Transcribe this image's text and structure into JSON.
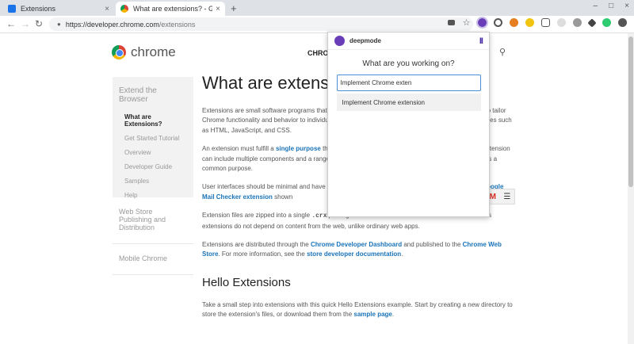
{
  "tabs": [
    {
      "title": "Extensions",
      "close": "×"
    },
    {
      "title": "What are extensions? - Google Chrome",
      "close": "×"
    }
  ],
  "new_tab": "+",
  "window_controls": {
    "minimize": "–",
    "maximize": "□",
    "close": "×"
  },
  "toolbar": {
    "back": "←",
    "forward": "→",
    "reload": "↻",
    "url_host": "https://developer.chrome.com",
    "url_path": "/extensions",
    "lock": "🔒",
    "star": "☆",
    "menu": "⋮"
  },
  "page": {
    "logo_text": "chrome",
    "topnav": "CHROME",
    "sidebar": {
      "heading": "Extend the Browser",
      "items": [
        "What are Extensions?",
        "Get Started Tutorial",
        "Overview",
        "Developer Guide",
        "Samples",
        "Help"
      ],
      "sections": [
        "Web Store Publishing and Distribution",
        "Mobile Chrome"
      ]
    },
    "h1": "What are extensions?",
    "p1": "Extensions are small software programs that customize the browsing experience. They enable users to tailor Chrome functionality and behavior to individual needs or preferences. They are built on web technologies such as HTML, JavaScript, and CSS.",
    "p2_a": "An extension must fulfill a ",
    "p2_link": "single purpose",
    "p2_b": " that is narrowly defined and easy to understand. A single extension can include multiple components and a range of functionality, as long as everything contributes towards a common purpose.",
    "p3_a": "User interfaces should be minimal and have intent. They can range from a simple icon, such as ",
    "p3_link": "the Google Mail Checker extension",
    "p3_b": " shown",
    "p4_a": "Extension files are zipped into a single ",
    "p4_code": ".crx",
    "p4_b": " package that the user downloads and installs. This means extensions do not depend on content from the web, unlike ordinary web apps.",
    "p5_a": "Extensions are distributed through the ",
    "p5_link1": "Chrome Developer Dashboard",
    "p5_b": " and published to the ",
    "p5_link2": "Chrome Web Store",
    "p5_c": ". For more information, see the ",
    "p5_link3": "store developer documentation",
    "p5_d": ".",
    "h2": "Hello Extensions",
    "p6_a": "Take a small step into extensions with this quick Hello Extensions example. Start by creating a new directory to store the extension's files, or download them from the ",
    "p6_link": "sample page",
    "p6_b": "."
  },
  "popup": {
    "name": "deepmode",
    "pause_icon": "II",
    "question": "What are you working on?",
    "input_value": "Implement Chrome exten",
    "suggestion": "Implement Chrome extension"
  },
  "colors": {
    "accent": "#4a90d9",
    "link": "#1a73b8",
    "brand": "#6a3db8"
  }
}
